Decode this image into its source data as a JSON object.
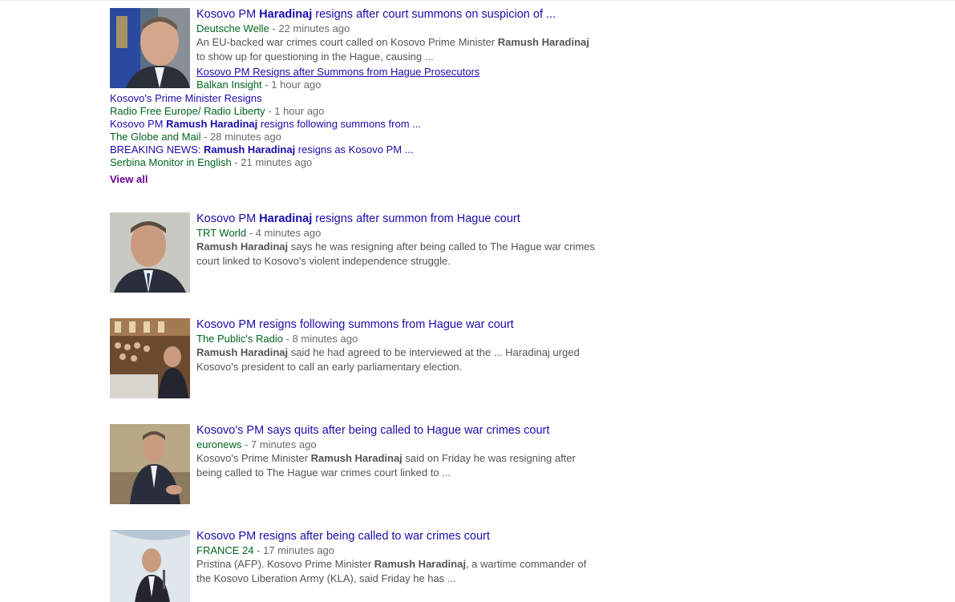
{
  "results": [
    {
      "thumb_icon": "portrait-photo-flag",
      "title_pre": "Kosovo PM ",
      "title_bold": "Haradinaj",
      "title_post": " resigns after court summons on suspicion of ...",
      "source": "Deutsche Welle",
      "time": " - 22 minutes ago",
      "snippet_pre": "An EU-backed war crimes court called on Kosovo Prime Minister ",
      "snippet_bold": "Ramush Haradinaj",
      "snippet_post": " to show up for questioning in the Hague, causing ...",
      "related": [
        {
          "pre": "Kosovo PM Resigns after Summons from Hague Prosecutors",
          "bold": "",
          "post": "",
          "source": "Balkan Insight",
          "time": " - 1 hour ago"
        },
        {
          "pre": "Kosovo's Prime Minister Resigns",
          "bold": "",
          "post": "",
          "source": "Radio Free Europe/ Radio Liberty",
          "time": " - 1 hour ago"
        },
        {
          "pre": "Kosovo PM ",
          "bold": "Ramush Haradinaj",
          "post": " resigns following summons from ...",
          "source": "The Globe and Mail",
          "time": " - 28 minutes ago"
        },
        {
          "pre": "BREAKING NEWS: ",
          "bold": "Ramush Haradinaj",
          "post": " resigns as Kosovo PM ...",
          "source": "Serbina Monitor in English",
          "time": " - 21 minutes ago"
        }
      ],
      "view_all": "View all"
    },
    {
      "thumb_icon": "portrait-photo",
      "title_pre": "Kosovo PM ",
      "title_bold": "Haradinaj",
      "title_post": " resigns after summon from Hague court",
      "source": "TRT World",
      "time": " - 4 minutes ago",
      "snippet_pre": "",
      "snippet_bold": "Ramush Haradinaj",
      "snippet_post": " says he was resigning after being called to The Hague war crimes court linked to Kosovo's violent independence struggle."
    },
    {
      "thumb_icon": "parliament-photo",
      "title_pre": "Kosovo PM resigns following summons from Hague war court",
      "title_bold": "",
      "title_post": "",
      "source": "The Public's Radio",
      "time": " - 8 minutes ago",
      "snippet_pre": "",
      "snippet_bold": "Ramush Haradinaj",
      "snippet_post": " said he had agreed to be interviewed at the ... Haradinaj urged Kosovo's president to call an early parliamentary election."
    },
    {
      "thumb_icon": "seated-portrait-photo",
      "title_pre": "Kosovo's PM says quits after being called to Hague war crimes court",
      "title_bold": "",
      "title_post": "",
      "source": "euronews",
      "time": " - 7 minutes ago",
      "snippet_pre": "Kosovo's Prime Minister ",
      "snippet_bold": "Ramush Haradinaj",
      "snippet_post": " said on Friday he was resigning after being called to The Hague war crimes court linked to ..."
    },
    {
      "thumb_icon": "podium-photo",
      "title_pre": "Kosovo PM resigns after being called to war crimes court",
      "title_bold": "",
      "title_post": "",
      "source": "FRANCE 24",
      "time": " - 17 minutes ago",
      "snippet_pre": "Pristina (AFP). Kosovo Prime Minister ",
      "snippet_bold": "Ramush Haradinaj",
      "snippet_post": ", a wartime commander of the Kosovo Liberation Army (KLA), said Friday he has ..."
    }
  ]
}
